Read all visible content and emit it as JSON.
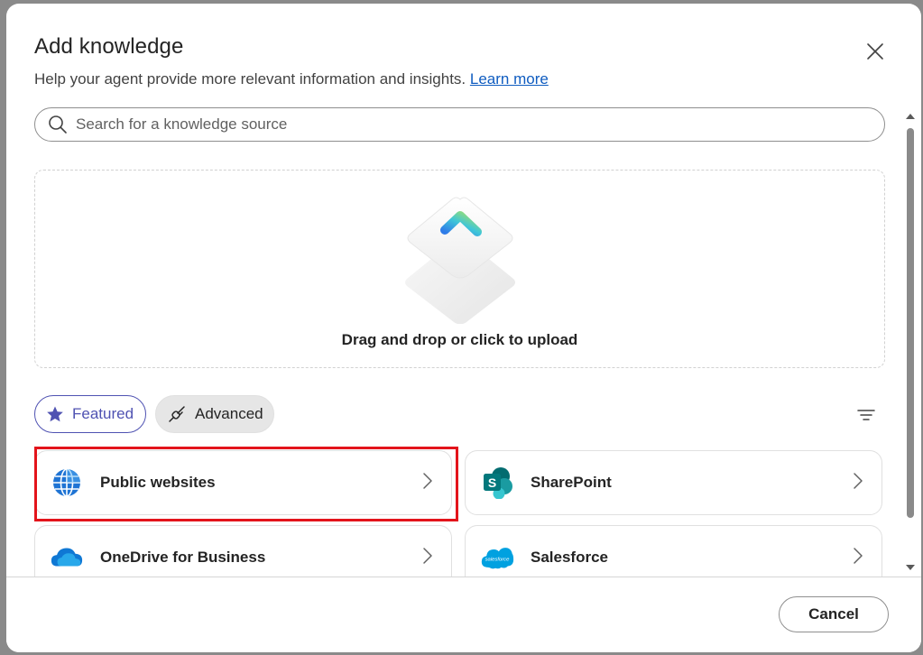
{
  "dialog": {
    "title": "Add knowledge",
    "subtitle": "Help your agent provide more relevant information and insights.",
    "learn_more": "Learn more"
  },
  "search": {
    "placeholder": "Search for a knowledge source"
  },
  "upload": {
    "text": "Drag and drop or click to upload"
  },
  "filters": {
    "featured": "Featured",
    "advanced": "Advanced",
    "selected": "Featured"
  },
  "sources": [
    {
      "label": "Public websites",
      "icon": "globe-icon"
    },
    {
      "label": "SharePoint",
      "icon": "sharepoint-icon"
    },
    {
      "label": "OneDrive for Business",
      "icon": "onedrive-icon"
    },
    {
      "label": "Salesforce",
      "icon": "salesforce-icon"
    }
  ],
  "footer": {
    "cancel": "Cancel"
  },
  "colors": {
    "accent": "#4f52b2",
    "link": "#0f5cc0",
    "highlight": "#e3141b"
  }
}
